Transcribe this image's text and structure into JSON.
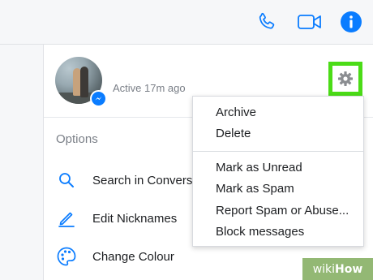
{
  "contact": {
    "status": "Active 17m ago"
  },
  "options": {
    "title": "Options",
    "items": [
      {
        "label": "Search in Conversation",
        "icon": "search-icon"
      },
      {
        "label": "Edit Nicknames",
        "icon": "pencil-icon"
      },
      {
        "label": "Change Colour",
        "icon": "palette-icon"
      }
    ]
  },
  "settings_menu": {
    "group1": [
      {
        "label": "Archive"
      },
      {
        "label": "Delete"
      }
    ],
    "group2": [
      {
        "label": "Mark as Unread"
      },
      {
        "label": "Mark as Spam"
      },
      {
        "label": "Report Spam or Abuse..."
      },
      {
        "label": "Block messages"
      }
    ]
  },
  "header_icons": [
    "phone-icon",
    "video-camera-icon",
    "info-icon"
  ],
  "watermark": {
    "wiki": "wiki",
    "how": "How"
  },
  "colors": {
    "accent": "#0a7cff",
    "highlight": "#4bdc17",
    "watermark_bg": "#93b874"
  }
}
